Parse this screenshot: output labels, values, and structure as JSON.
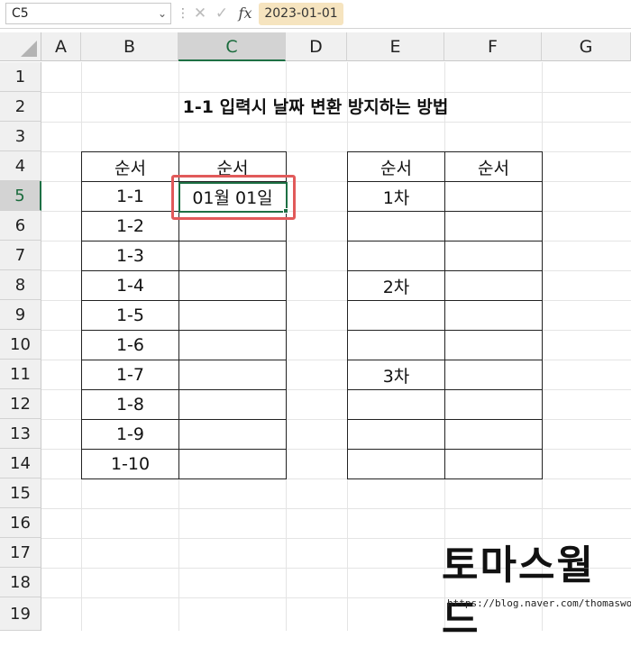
{
  "formula_bar": {
    "name_box": "C5",
    "cancel_icon": "close-icon",
    "enter_icon": "check-icon",
    "fx_label": "fx",
    "content": "2023-01-01"
  },
  "columns": [
    "A",
    "B",
    "C",
    "D",
    "E",
    "F",
    "G"
  ],
  "selected_column": "C",
  "rows": [
    "1",
    "2",
    "3",
    "4",
    "5",
    "6",
    "7",
    "8",
    "9",
    "10",
    "11",
    "12",
    "13",
    "14",
    "15",
    "16",
    "17",
    "18",
    "19"
  ],
  "selected_row": "5",
  "sheet": {
    "title": "1-1 입력시 날짜 변환 방지하는 방법",
    "left_table": {
      "headers": [
        "순서",
        "순서"
      ],
      "rows": [
        [
          "1-1",
          "01월 01일"
        ],
        [
          "1-2",
          ""
        ],
        [
          "1-3",
          ""
        ],
        [
          "1-4",
          ""
        ],
        [
          "1-5",
          ""
        ],
        [
          "1-6",
          ""
        ],
        [
          "1-7",
          ""
        ],
        [
          "1-8",
          ""
        ],
        [
          "1-9",
          ""
        ],
        [
          "1-10",
          ""
        ]
      ]
    },
    "right_table": {
      "headers": [
        "순서",
        "순서"
      ],
      "rows": [
        [
          "1차",
          ""
        ],
        [
          "",
          ""
        ],
        [
          "",
          ""
        ],
        [
          "2차",
          ""
        ],
        [
          "",
          ""
        ],
        [
          "",
          ""
        ],
        [
          "3차",
          ""
        ],
        [
          "",
          ""
        ],
        [
          "",
          ""
        ],
        [
          "",
          ""
        ]
      ]
    }
  },
  "watermark": {
    "title": "토마스월드",
    "url": "https://blog.naver.com/thomasworld"
  },
  "colors": {
    "selection": "#1d7044",
    "highlight_box": "#e15a5a",
    "formula_highlight": "#f6e4bf"
  }
}
